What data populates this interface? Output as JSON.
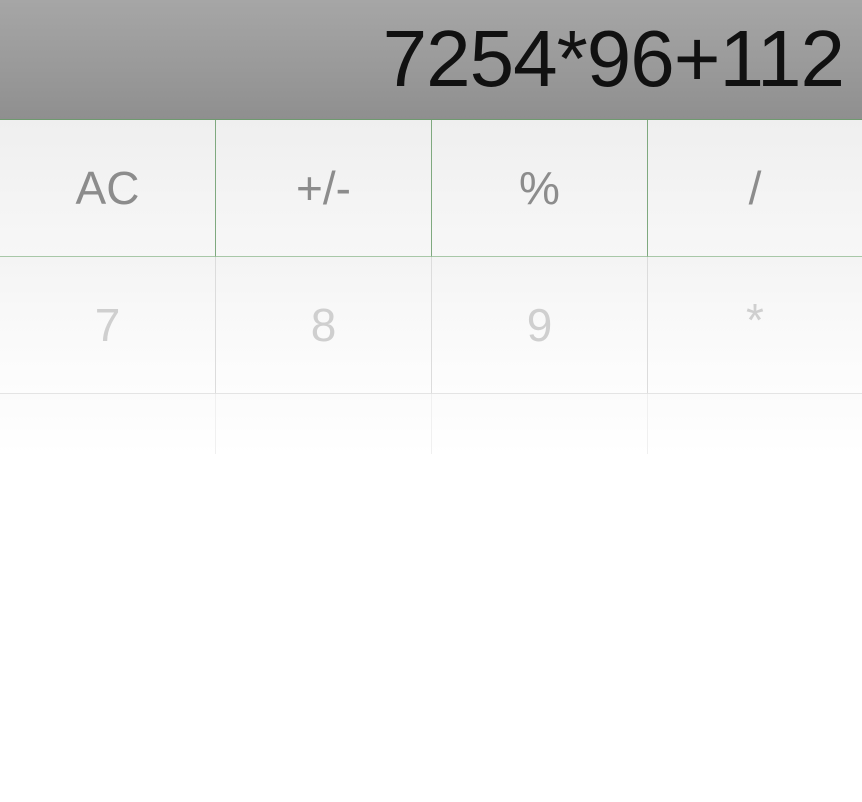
{
  "display": {
    "expression": "7254*96+112"
  },
  "keypad": {
    "row1": [
      "AC",
      "+/-",
      "%",
      "/"
    ],
    "row2": [
      "7",
      "8",
      "9",
      "*"
    ]
  }
}
